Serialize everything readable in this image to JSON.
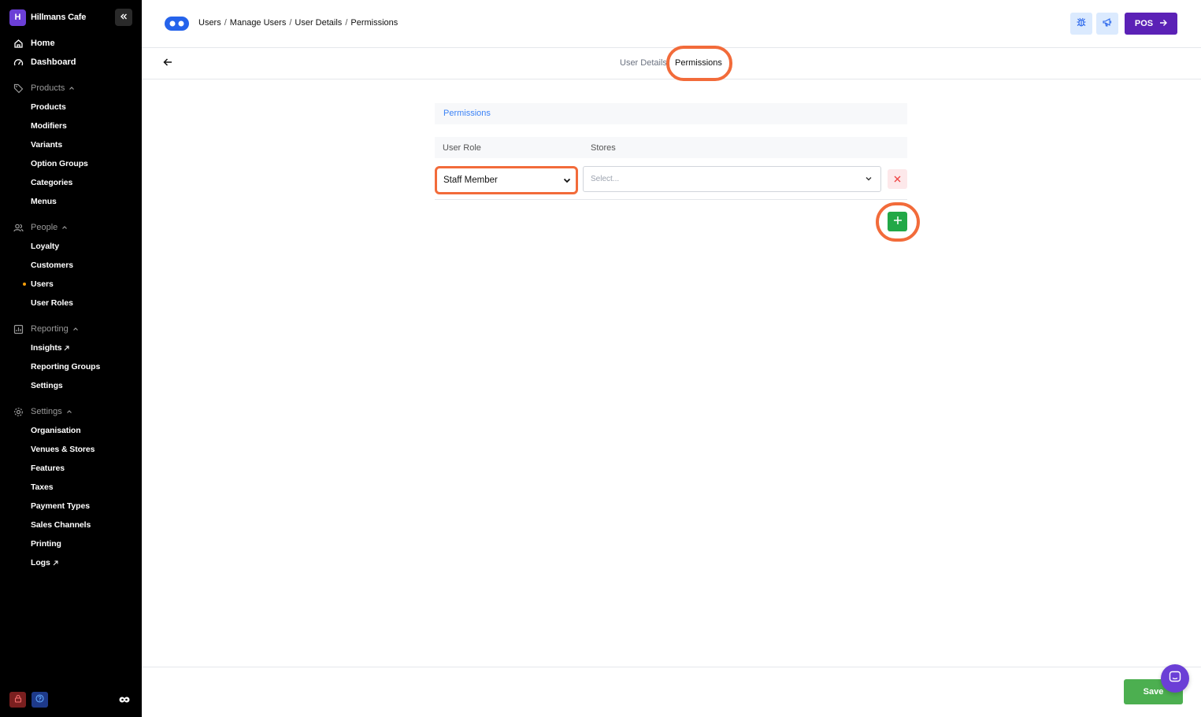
{
  "brand": {
    "initial": "H",
    "name": "Hillmans Cafe"
  },
  "colors": {
    "accent": "#5b21b6",
    "highlight": "#f26b3a",
    "save": "#4caf50",
    "add": "#22a847",
    "remove_bg": "#fde8ea",
    "link": "#3b82f6"
  },
  "sidebar": {
    "top_items": [
      {
        "label": "Home",
        "icon": "home-icon"
      },
      {
        "label": "Dashboard",
        "icon": "gauge-icon"
      }
    ],
    "sections": {
      "products": {
        "label": "Products",
        "icon": "tag-icon",
        "items": [
          "Products",
          "Modifiers",
          "Variants",
          "Option Groups",
          "Categories",
          "Menus"
        ]
      },
      "people": {
        "label": "People",
        "icon": "people-icon",
        "items": [
          "Loyalty",
          "Customers",
          "Users",
          "User Roles"
        ],
        "active": "Users"
      },
      "reporting": {
        "label": "Reporting",
        "icon": "chart-icon",
        "items": [
          "Insights",
          "Reporting Groups",
          "Settings"
        ]
      },
      "settings": {
        "label": "Settings",
        "icon": "gear-icon",
        "items": [
          "Organisation",
          "Venues & Stores",
          "Features",
          "Taxes",
          "Payment Types",
          "Sales Channels",
          "Printing",
          "Logs"
        ]
      }
    }
  },
  "header": {
    "breadcrumb": [
      "Users",
      "Manage Users",
      "User Details",
      "Permissions"
    ],
    "separator": "/",
    "pos_label": "POS"
  },
  "tabs": {
    "user_details": "User Details",
    "permissions": "Permissions"
  },
  "form": {
    "section_title": "Permissions",
    "columns": {
      "role": "User Role",
      "stores": "Stores"
    },
    "role_value": "Staff Member",
    "stores_placeholder": "Select..."
  },
  "footer": {
    "save_label": "Save"
  }
}
